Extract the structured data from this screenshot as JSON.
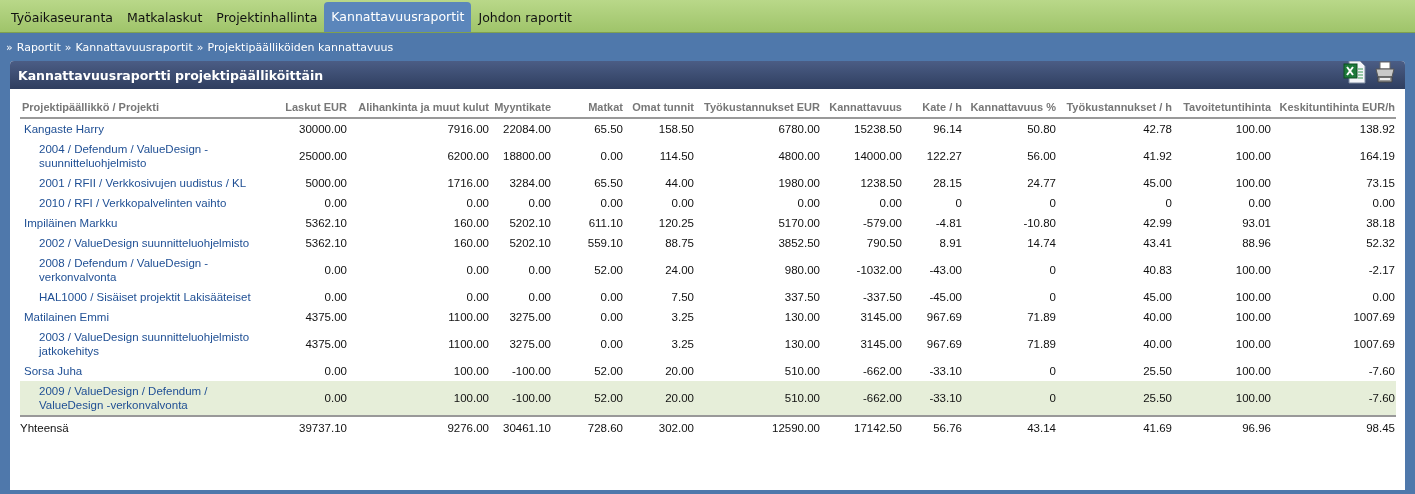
{
  "tabs": [
    {
      "label": "Työaikaseuranta",
      "selected": false
    },
    {
      "label": "Matkalaskut",
      "selected": false
    },
    {
      "label": "Projektinhallinta",
      "selected": false
    },
    {
      "label": "Kannattavuusraportit",
      "selected": true
    },
    {
      "label": "Johdon raportit",
      "selected": false
    }
  ],
  "breadcrumb": {
    "separator": "»",
    "items": [
      "Raportit",
      "Kannattavuusraportit",
      "Projektipäälliköiden kannattavuus"
    ]
  },
  "panel": {
    "title": "Kannattavuusraportti projektipäälliköittäin"
  },
  "table": {
    "columns": [
      "Projektipäällikkö / Projekti",
      "Laskut EUR",
      "Alihankinta ja muut kulut",
      "Myyntikate",
      "Matkat",
      "Omat tunnit",
      "Työkustannukset EUR",
      "Kannattavuus",
      "Kate / h",
      "Kannattavuus %",
      "Työkustannukset / h",
      "Tavoitetuntihinta",
      "Keskituntihinta EUR/h"
    ],
    "rows": [
      {
        "kind": "manager",
        "selected": false,
        "name": "Kangaste Harry",
        "values": [
          "30000.00",
          "7916.00",
          "22084.00",
          "65.50",
          "158.50",
          "6780.00",
          "15238.50",
          "96.14",
          "50.80",
          "42.78",
          "100.00",
          "138.92"
        ]
      },
      {
        "kind": "project",
        "selected": false,
        "name": "2004 / Defendum / ValueDesign -suunnitteluohjelmisto",
        "values": [
          "25000.00",
          "6200.00",
          "18800.00",
          "0.00",
          "114.50",
          "4800.00",
          "14000.00",
          "122.27",
          "56.00",
          "41.92",
          "100.00",
          "164.19"
        ]
      },
      {
        "kind": "project",
        "selected": false,
        "name": "2001 / RFII / Verkkosivujen uudistus / KL",
        "values": [
          "5000.00",
          "1716.00",
          "3284.00",
          "65.50",
          "44.00",
          "1980.00",
          "1238.50",
          "28.15",
          "24.77",
          "45.00",
          "100.00",
          "73.15"
        ]
      },
      {
        "kind": "project",
        "selected": false,
        "name": "2010 / RFI / Verkkopalvelinten vaihto",
        "values": [
          "0.00",
          "0.00",
          "0.00",
          "0.00",
          "0.00",
          "0.00",
          "0.00",
          "0",
          "0",
          "0",
          "0.00",
          "0.00"
        ]
      },
      {
        "kind": "manager",
        "selected": false,
        "name": "Impiläinen Markku",
        "values": [
          "5362.10",
          "160.00",
          "5202.10",
          "611.10",
          "120.25",
          "5170.00",
          "-579.00",
          "-4.81",
          "-10.80",
          "42.99",
          "93.01",
          "38.18"
        ]
      },
      {
        "kind": "project",
        "selected": false,
        "name": "2002 / ValueDesign suunnitteluohjelmisto",
        "values": [
          "5362.10",
          "160.00",
          "5202.10",
          "559.10",
          "88.75",
          "3852.50",
          "790.50",
          "8.91",
          "14.74",
          "43.41",
          "88.96",
          "52.32"
        ]
      },
      {
        "kind": "project",
        "selected": false,
        "name": "2008 / Defendum / ValueDesign -verkonvalvonta",
        "values": [
          "0.00",
          "0.00",
          "0.00",
          "52.00",
          "24.00",
          "980.00",
          "-1032.00",
          "-43.00",
          "0",
          "40.83",
          "100.00",
          "-2.17"
        ]
      },
      {
        "kind": "project",
        "selected": false,
        "name": "HAL1000 / Sisäiset projektit Lakisääteiset",
        "values": [
          "0.00",
          "0.00",
          "0.00",
          "0.00",
          "7.50",
          "337.50",
          "-337.50",
          "-45.00",
          "0",
          "45.00",
          "100.00",
          "0.00"
        ]
      },
      {
        "kind": "manager",
        "selected": false,
        "name": "Matilainen Emmi",
        "values": [
          "4375.00",
          "1100.00",
          "3275.00",
          "0.00",
          "3.25",
          "130.00",
          "3145.00",
          "967.69",
          "71.89",
          "40.00",
          "100.00",
          "1007.69"
        ]
      },
      {
        "kind": "project",
        "selected": false,
        "name": "2003 / ValueDesign suunnitteluohjelmisto jatkokehitys",
        "values": [
          "4375.00",
          "1100.00",
          "3275.00",
          "0.00",
          "3.25",
          "130.00",
          "3145.00",
          "967.69",
          "71.89",
          "40.00",
          "100.00",
          "1007.69"
        ]
      },
      {
        "kind": "manager",
        "selected": false,
        "name": "Sorsa Juha",
        "values": [
          "0.00",
          "100.00",
          "-100.00",
          "52.00",
          "20.00",
          "510.00",
          "-662.00",
          "-33.10",
          "0",
          "25.50",
          "100.00",
          "-7.60"
        ]
      },
      {
        "kind": "project",
        "selected": true,
        "name": "2009 / ValueDesign / Defendum / ValueDesign -verkonvalvonta",
        "values": [
          "0.00",
          "100.00",
          "-100.00",
          "52.00",
          "20.00",
          "510.00",
          "-662.00",
          "-33.10",
          "0",
          "25.50",
          "100.00",
          "-7.60"
        ]
      }
    ],
    "total": {
      "label": "Yhteensä",
      "values": [
        "39737.10",
        "9276.00",
        "30461.10",
        "728.60",
        "302.00",
        "12590.00",
        "17142.50",
        "56.76",
        "43.14",
        "41.69",
        "96.96",
        "98.45"
      ]
    }
  }
}
